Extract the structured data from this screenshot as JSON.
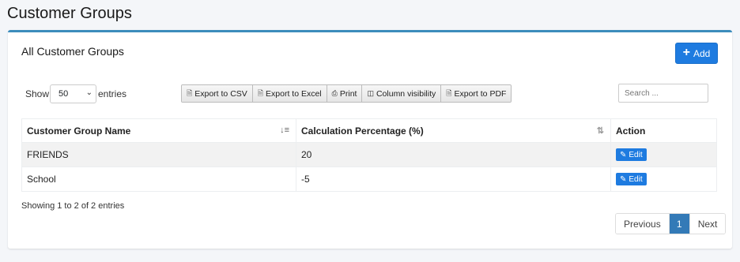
{
  "page": {
    "title": "Customer Groups"
  },
  "card": {
    "title": "All Customer Groups",
    "add_label": "Add"
  },
  "controls": {
    "show_label": "Show",
    "entries_label": "entries",
    "page_length": "50",
    "search_placeholder": "Search ..."
  },
  "export_buttons": [
    "Export to CSV",
    "Export to Excel",
    "Print",
    "Column visibility",
    "Export to PDF"
  ],
  "table": {
    "columns": [
      "Customer Group Name",
      "Calculation Percentage (%)",
      "Action"
    ],
    "rows": [
      {
        "name": "FRIENDS",
        "percentage": "20",
        "action": "Edit"
      },
      {
        "name": "School",
        "percentage": "-5",
        "action": "Edit"
      }
    ]
  },
  "footer": {
    "info": "Showing 1 to 2 of 2 entries",
    "previous": "Previous",
    "current_page": "1",
    "next": "Next"
  },
  "colors": {
    "primary": "#1e7be0",
    "card_border": "#3c8dbc",
    "active_page": "#337ab7"
  }
}
